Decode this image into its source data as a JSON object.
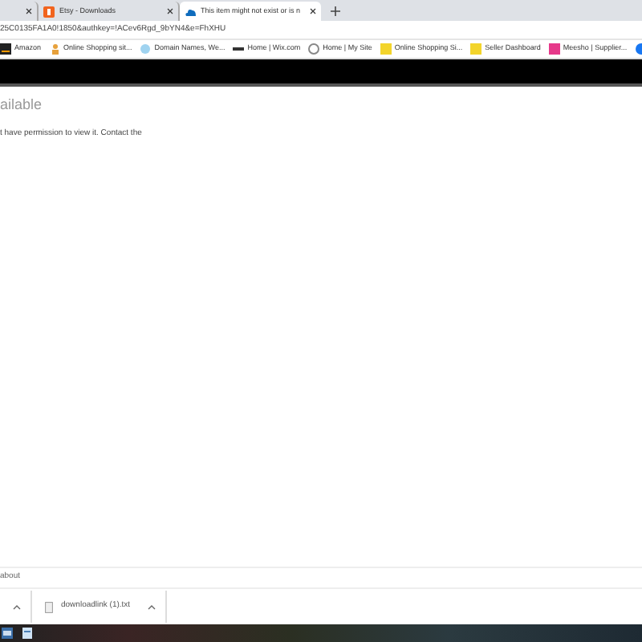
{
  "tabs": [
    {
      "selected": false
    },
    {
      "title": "Etsy - Downloads",
      "selected": false
    },
    {
      "title": "This item might not exist or is n",
      "selected": true
    }
  ],
  "address_bar": {
    "url": "25C0135FA1A0!1850&authkey=!ACev6Rgd_9bYN4&e=FhXHU"
  },
  "bookmarks": [
    {
      "label": "Amazon"
    },
    {
      "label": "Online Shopping sit..."
    },
    {
      "label": "Domain Names, We..."
    },
    {
      "label": "Home | Wix.com"
    },
    {
      "label": "Home | My Site"
    },
    {
      "label": "Online Shopping Si..."
    },
    {
      "label": "Seller Dashboard"
    },
    {
      "label": "Meesho | Supplier..."
    }
  ],
  "page": {
    "heading": "ailable",
    "message": "t have permission to view it. Contact the"
  },
  "status_text": "about",
  "downloads": [
    {
      "name": "downloadlink (1).txt"
    }
  ]
}
